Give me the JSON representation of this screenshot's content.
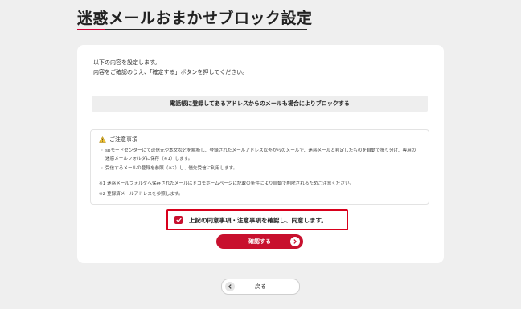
{
  "page": {
    "title": "迷惑メールおまかせブロック設定"
  },
  "intro": {
    "line1": "以下の内容を設定します。",
    "line2": "内容をご確認のうえ、「確定する」ボタンを押してください。"
  },
  "setting": {
    "value": "電話帳に登録してあるアドレスからのメールも場合によりブロックする"
  },
  "notes": {
    "heading": "ご注意事項",
    "items": [
      "spモードセンターにて送信元や本文などを解析し、登録されたメールアドレス以外からのメールで、迷惑メールと判定したものを自動で振り分け、専用の迷惑メールフォルダに保存（※1）します。",
      "受信するメールの登録を参照（※2）し、優先受信に利用します。"
    ],
    "footnotes": [
      "※1 迷惑メールフォルダへ保存されたメールはドコモホームページに記載の条件により自動で削除されるためご注意ください。",
      "※2 登録済メールアドレスを参照します。"
    ]
  },
  "agree": {
    "label": "上記の同意事項・注意事項を確認し、同意します。",
    "checked": true
  },
  "buttons": {
    "confirm_label": "確認する",
    "back_label": "戻る"
  },
  "colors": {
    "accent": "#c8102e",
    "background": "#efefef"
  },
  "icons": {
    "warning": "warning-icon",
    "confirm_arrow": "chevron-right-icon",
    "back_arrow": "chevron-left-icon",
    "checkbox": "check-icon"
  }
}
